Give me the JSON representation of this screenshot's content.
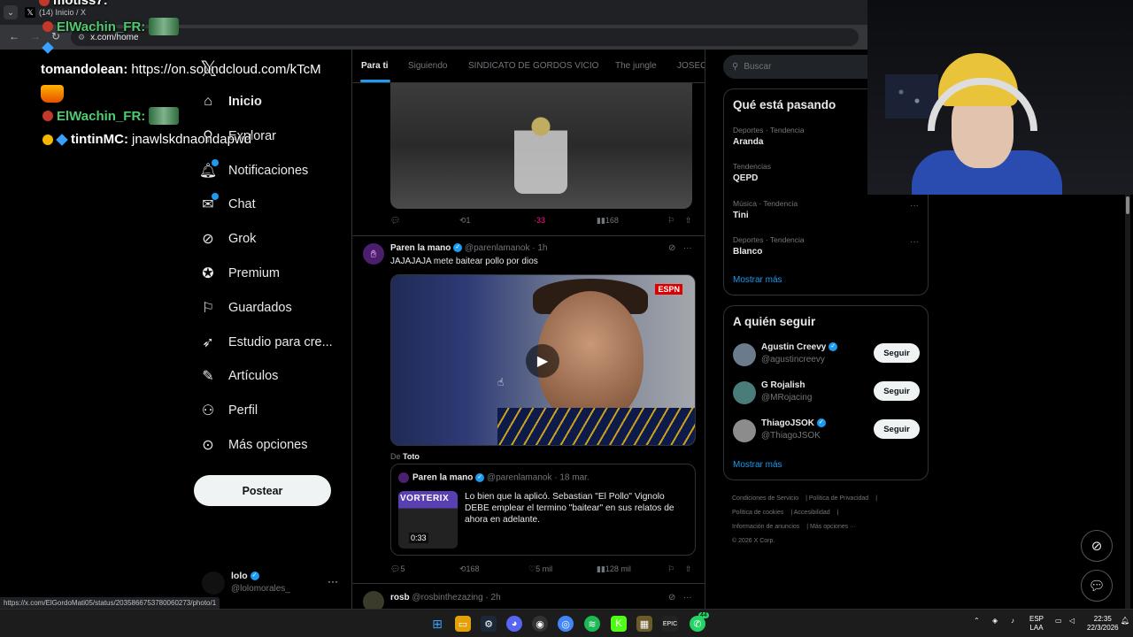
{
  "browser": {
    "tab_title": "(14) Inicio / X",
    "url": "x.com/home",
    "status_url": "https://x.com/ElGordoMati05/status/2035866753780060273/photo/1"
  },
  "chat": {
    "lines": [
      {
        "user": "motiss7:",
        "msg": ""
      },
      {
        "user": "ElWachin_FR:",
        "msg": ""
      },
      {
        "user": "tomandolean:",
        "msg": "https://on.soundcloud.com/kTcM"
      },
      {
        "user": "ElWachin_FR:",
        "msg": ""
      },
      {
        "user": "tintinMC:",
        "msg": "jnawlskdnaondapwd"
      }
    ]
  },
  "sidebar": {
    "items": [
      {
        "label": "Inicio",
        "icon": "home-icon"
      },
      {
        "label": "Explorar",
        "icon": "search-icon"
      },
      {
        "label": "Notificaciones",
        "icon": "bell-icon"
      },
      {
        "label": "Chat",
        "icon": "mail-icon"
      },
      {
        "label": "Grok",
        "icon": "grok-icon"
      },
      {
        "label": "Premium",
        "icon": "premium-icon"
      },
      {
        "label": "Guardados",
        "icon": "bookmark-icon"
      },
      {
        "label": "Estudio para cre...",
        "icon": "rocket-icon"
      },
      {
        "label": "Artículos",
        "icon": "articles-icon"
      },
      {
        "label": "Perfil",
        "icon": "person-icon"
      },
      {
        "label": "Más opciones",
        "icon": "more-icon"
      }
    ],
    "post_label": "Postear",
    "profile": {
      "name": "lolo",
      "handle": "@lolomorales_"
    }
  },
  "feed": {
    "tabs": [
      "Para ti",
      "Siguiendo",
      "SINDICATO DE GORDOS VICIO",
      "The jungle",
      "JOSEO"
    ],
    "tweet1_actions": {
      "retweets": "1",
      "likes": "33",
      "views": "168"
    },
    "tweet2": {
      "name": "Paren la mano",
      "handle": "@parenlamanok",
      "time": "· 1h",
      "text": "JAJAJAJA mete baitear pollo por dios",
      "video_logo": "ESPN",
      "de_label": "De",
      "de_name": "Toto",
      "quote": {
        "name": "Paren la mano",
        "handle": "@parenlamanok",
        "time": "· 18 mar.",
        "text": "Lo bien que la aplicó. Sebastian \"El Pollo\" Vignolo DEBE emplear el termino \"baitear\" en sus relatos de ahora en adelante.",
        "thumb_text": "VORTERIX",
        "duration": "0:33"
      },
      "actions": {
        "replies": "5",
        "retweets": "168",
        "likes": "5 mil",
        "views": "128 mil"
      }
    },
    "tweet3": {
      "name": "rosb",
      "handle": "@rosbinthezazing",
      "time": "· 2h"
    }
  },
  "right": {
    "search_placeholder": "Buscar",
    "trends_title": "Qué está pasando",
    "trends": [
      {
        "cat": "Deportes · Tendencia",
        "name": "Aranda"
      },
      {
        "cat": "Tendencias",
        "name": "QEPD"
      },
      {
        "cat": "Música · Tendencia",
        "name": "Tini"
      },
      {
        "cat": "Deportes · Tendencia",
        "name": "Blanco"
      }
    ],
    "show_more": "Mostrar más",
    "follow_title": "A quién seguir",
    "follow": [
      {
        "name": "Agustin Creevy",
        "handle": "@agustincreevy"
      },
      {
        "name": "G Rojalish",
        "handle": "@MRojacing"
      },
      {
        "name": "ThiagoJSOK",
        "handle": "@ThiagoJSOK"
      }
    ],
    "follow_label": "Seguir",
    "footer": [
      "Condiciones de Servicio",
      "Política de Privacidad",
      "Política de cookies",
      "Accesibilidad",
      "Información de anuncios",
      "Más opciones ···",
      "© 2026 X Corp."
    ]
  },
  "taskbar": {
    "lang1": "ESP",
    "lang2": "LAA",
    "time": "22:35",
    "date": "22/3/2026",
    "whatsapp_badge": "44"
  },
  "colors": {
    "accent": "#1d9bf0",
    "like": "#f91880",
    "bg": "#000000"
  }
}
